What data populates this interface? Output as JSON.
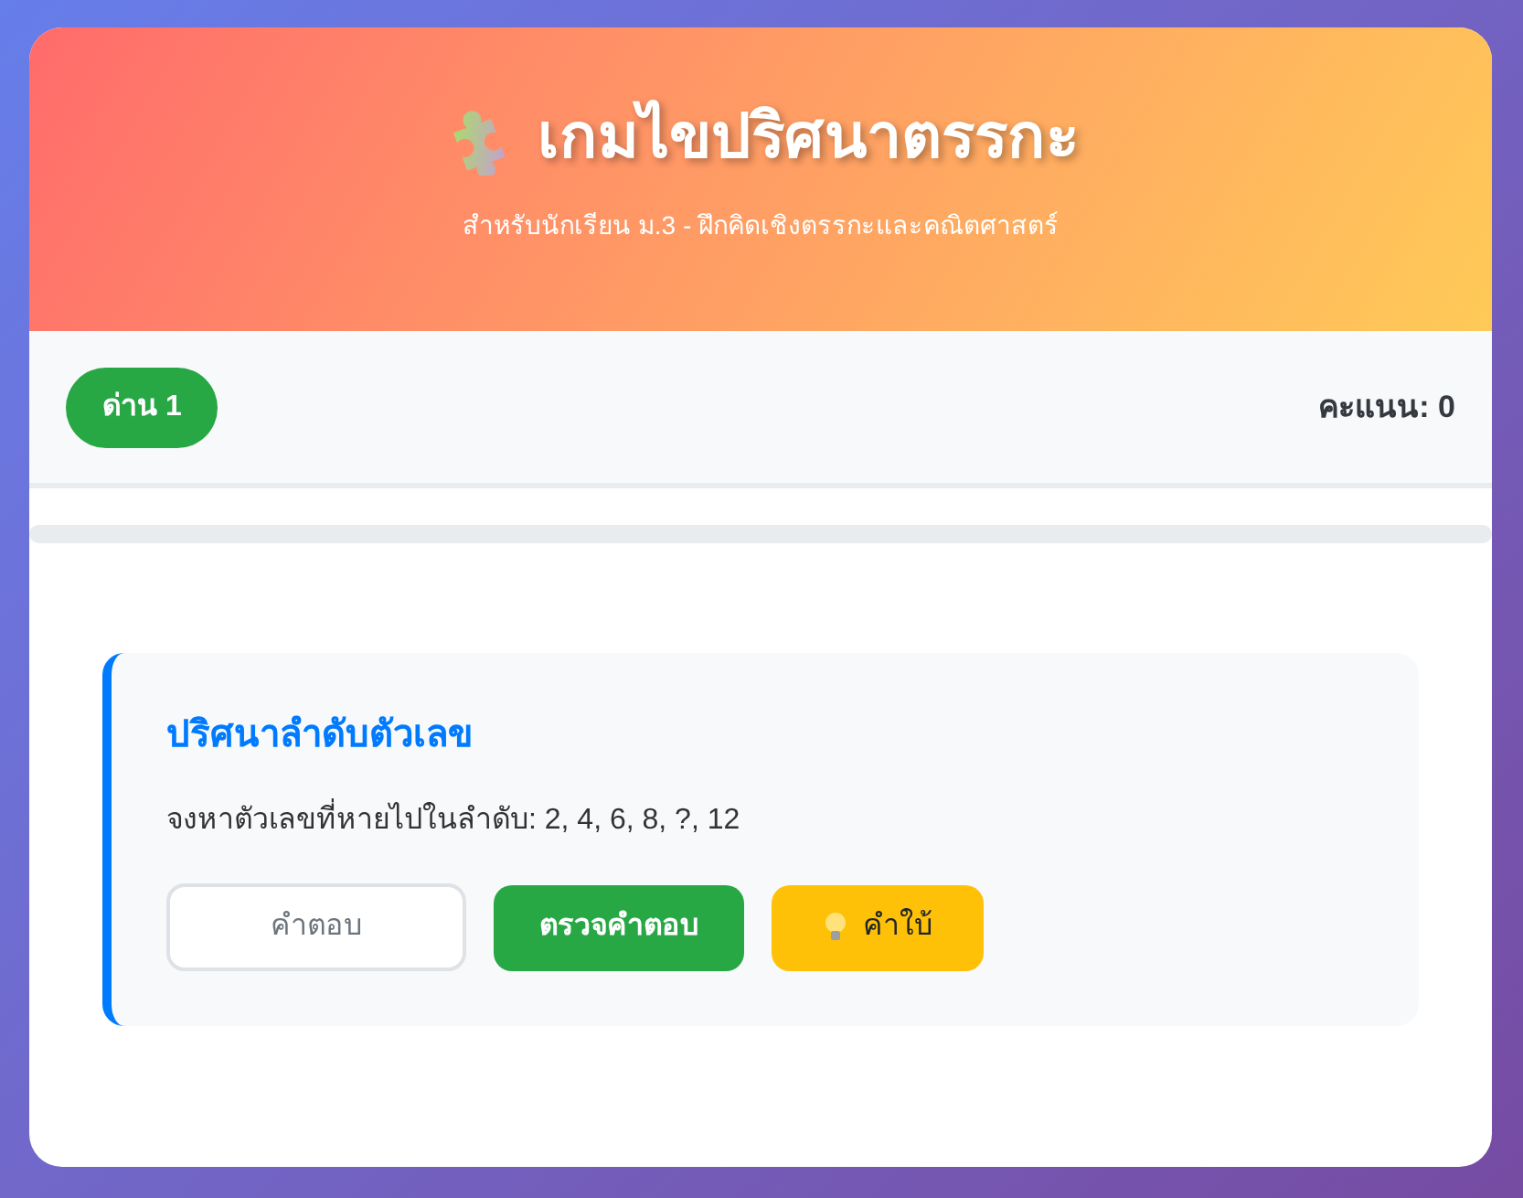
{
  "header": {
    "title": "เกมไขปริศนาตรรกะ",
    "subtitle": "สำหรับนักเรียน ม.3 - ฝึกคิดเชิงตรรกะและคณิตศาสตร์"
  },
  "stats": {
    "level_badge": "ด่าน 1",
    "score": "คะแนน: 0"
  },
  "progress": {
    "level": 0
  },
  "puzzle": {
    "title": "ปริศนาลำดับตัวเลข",
    "question": "จงหาตัวเลขที่หายไปในลำดับ: 2, 4, 6, 8, ?, 12",
    "answer": {
      "placeholder": "คำตอบ"
    },
    "check_button": "ตรวจคำตอบ",
    "hint_button": "คำใบ้"
  }
}
